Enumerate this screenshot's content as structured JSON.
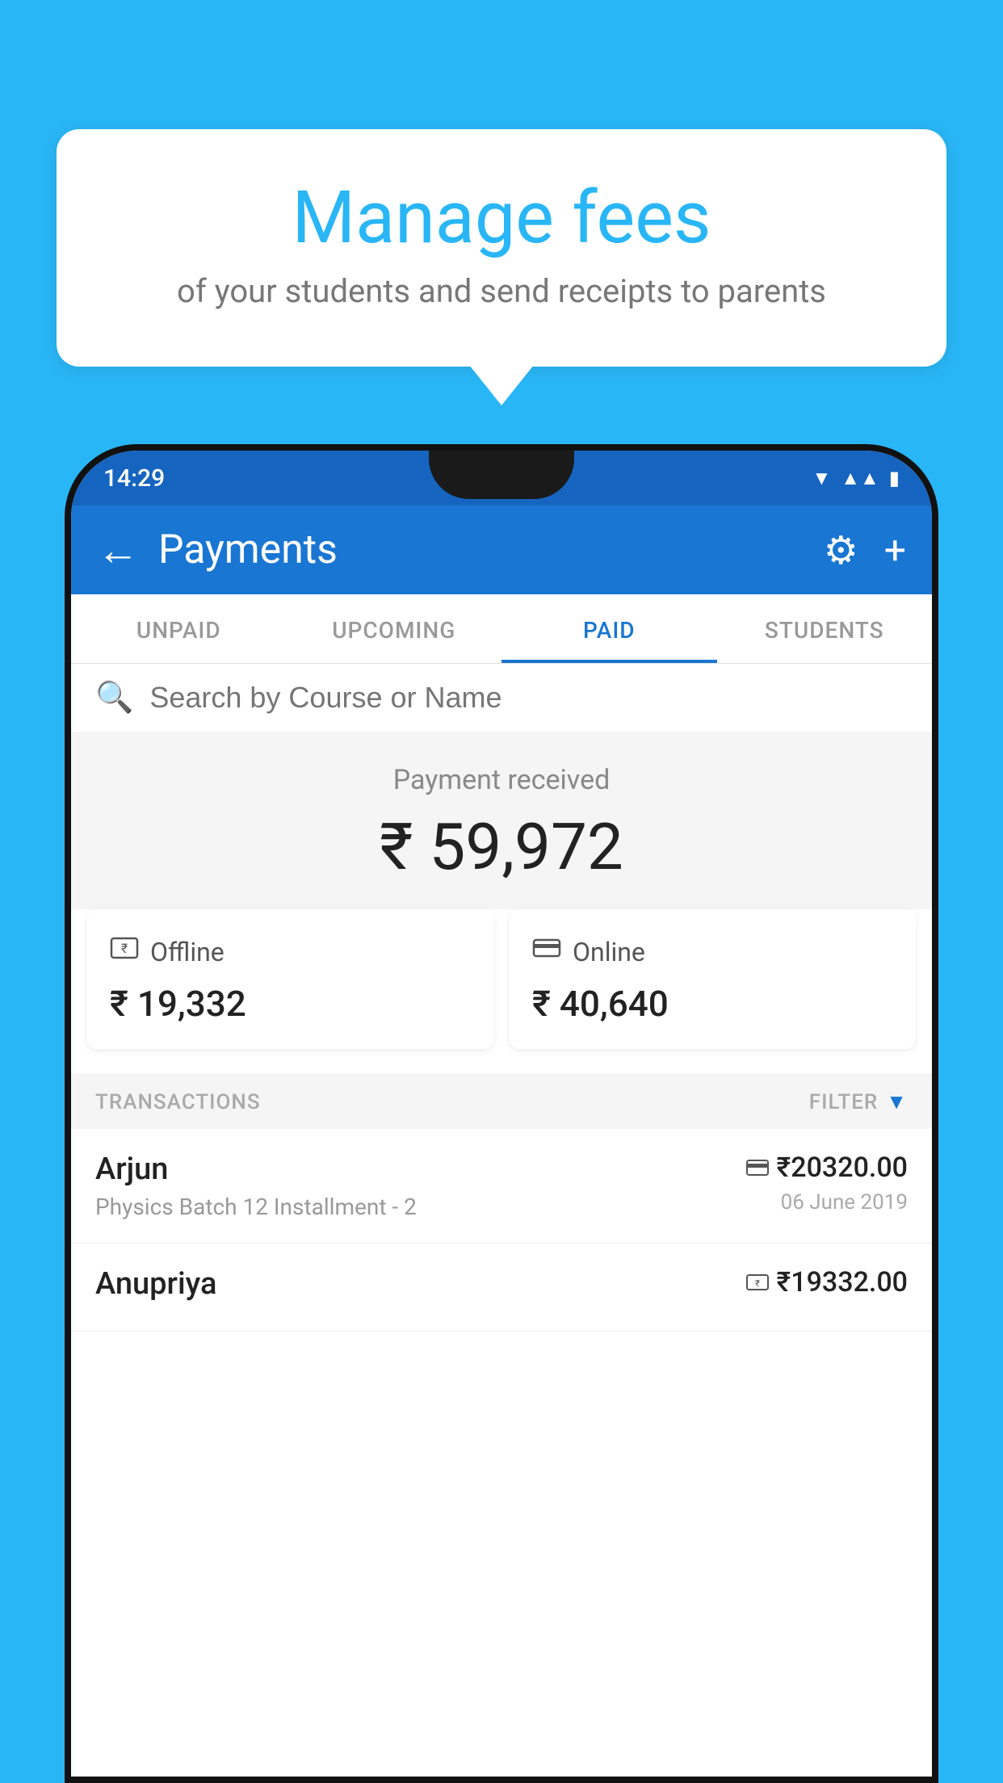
{
  "background_color": "#29B6F6",
  "speech_bubble": {
    "title": "Manage fees",
    "subtitle": "of your students and send receipts to parents"
  },
  "phone": {
    "status_bar": {
      "time": "14:29",
      "icons": [
        "wifi",
        "signal",
        "battery"
      ]
    },
    "app_bar": {
      "title": "Payments",
      "back_label": "←",
      "settings_label": "⚙",
      "add_label": "+"
    },
    "tabs": [
      {
        "label": "UNPAID",
        "active": false
      },
      {
        "label": "UPCOMING",
        "active": false
      },
      {
        "label": "PAID",
        "active": true
      },
      {
        "label": "STUDENTS",
        "active": false
      }
    ],
    "search": {
      "placeholder": "Search by Course or Name"
    },
    "payment_received": {
      "label": "Payment received",
      "amount": "₹ 59,972"
    },
    "cards": [
      {
        "type": "Offline",
        "amount": "₹ 19,332",
        "icon": "💳"
      },
      {
        "type": "Online",
        "amount": "₹ 40,640",
        "icon": "💳"
      }
    ],
    "transactions_label": "TRANSACTIONS",
    "filter_label": "FILTER",
    "transactions": [
      {
        "name": "Arjun",
        "course": "Physics Batch 12 Installment - 2",
        "amount": "₹20320.00",
        "date": "06 June 2019",
        "payment_type": "online"
      },
      {
        "name": "Anupriya",
        "course": "",
        "amount": "₹19332.00",
        "date": "",
        "payment_type": "offline"
      }
    ]
  }
}
